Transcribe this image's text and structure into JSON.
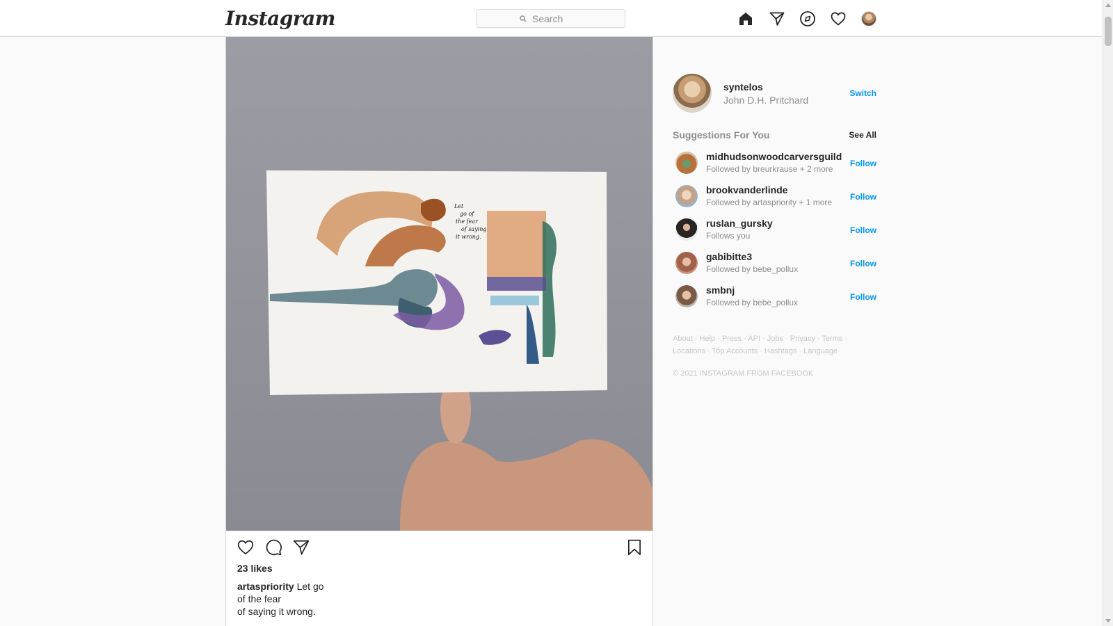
{
  "header": {
    "logo": "Instagram",
    "search_placeholder": "Search",
    "icons": [
      "home-icon",
      "direct-icon",
      "explore-icon",
      "activity-heart-icon",
      "profile-avatar"
    ]
  },
  "post": {
    "likes": "23 likes",
    "caption_user": "artaspriority",
    "caption_lines": [
      "Let go",
      "of the fear",
      "of saying it wrong."
    ],
    "actions": [
      "like-heart-icon",
      "comment-icon",
      "share-icon",
      "save-bookmark-icon"
    ]
  },
  "sidebar": {
    "me": {
      "username": "syntelos",
      "fullname": "John D.H. Pritchard",
      "switch_label": "Switch"
    },
    "suggestions_title": "Suggestions For You",
    "see_all": "See All",
    "follow_label": "Follow",
    "suggestions": [
      {
        "username": "midhudsonwoodcarversguild",
        "subtitle": "Followed by breurkrause + 2 more"
      },
      {
        "username": "brookvanderlinde",
        "subtitle": "Followed by artaspriority + 1 more"
      },
      {
        "username": "ruslan_gursky",
        "subtitle": "Follows you"
      },
      {
        "username": "gabibitte3",
        "subtitle": "Followed by bebe_pollux"
      },
      {
        "username": "smbnj",
        "subtitle": "Followed by bebe_pollux"
      }
    ],
    "footer_links": [
      "About",
      "Help",
      "Press",
      "API",
      "Jobs",
      "Privacy",
      "Terms",
      "Locations",
      "Top Accounts",
      "Hashtags",
      "Language"
    ],
    "copyright": "© 2021 INSTAGRAM FROM FACEBOOK"
  },
  "colors": {
    "link_blue": "#0095f6",
    "secondary_text": "#8e8e8e",
    "border": "#dbdbdb",
    "page_bg": "#fafafa"
  }
}
